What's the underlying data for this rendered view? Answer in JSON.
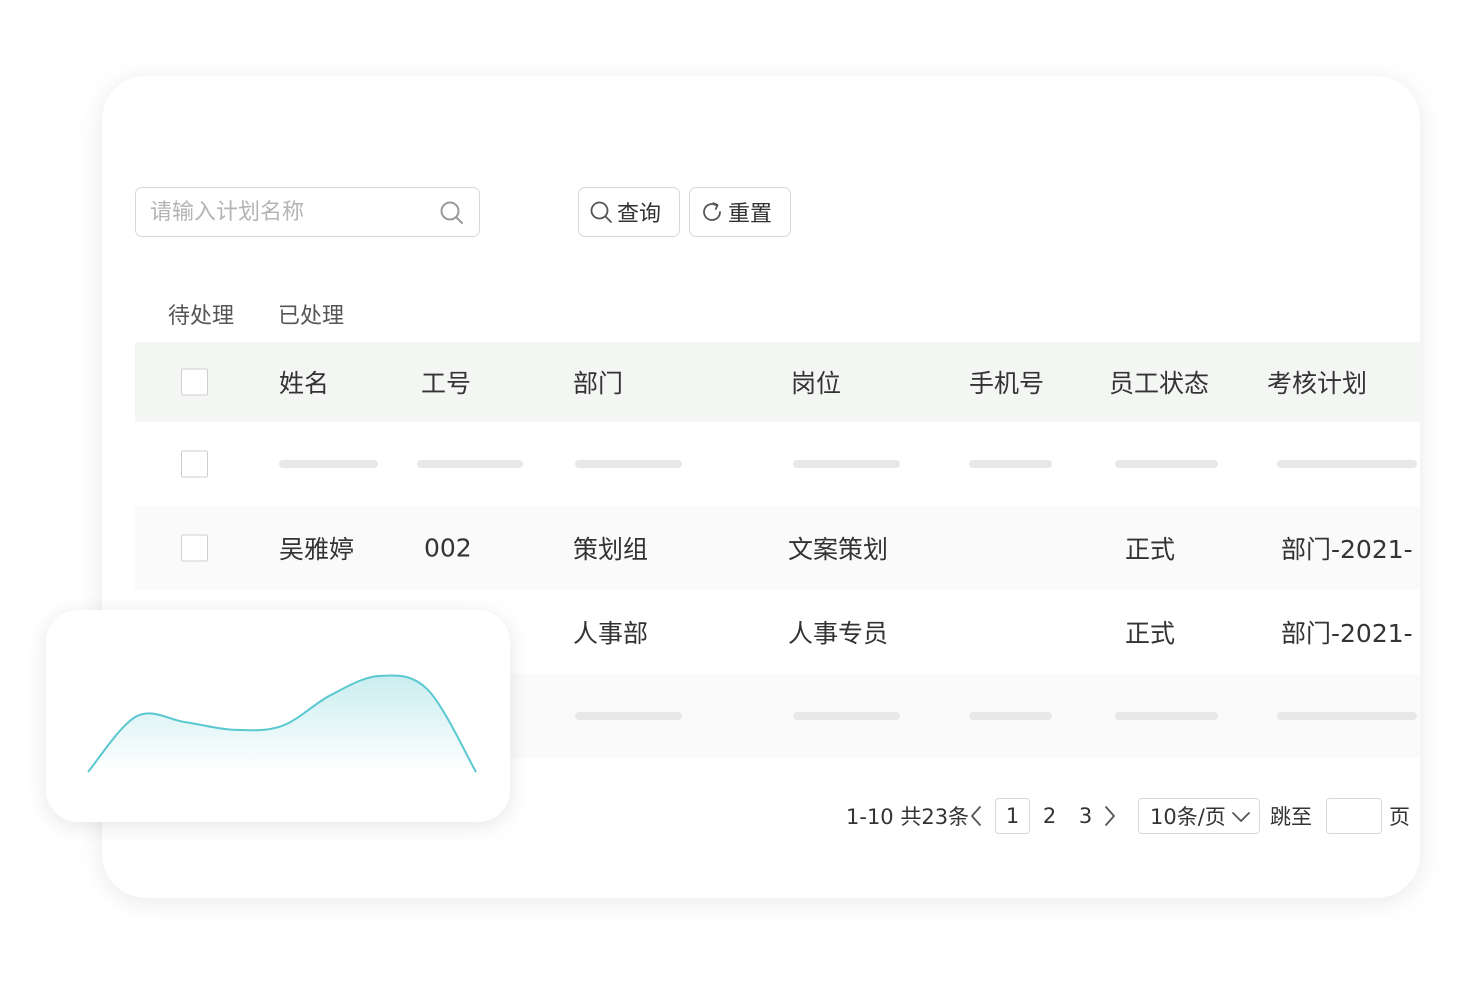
{
  "search": {
    "placeholder": "请输入计划名称"
  },
  "toolbar": {
    "query_label": "查询",
    "reset_label": "重置"
  },
  "tabs": [
    {
      "label": "待处理"
    },
    {
      "label": "已处理"
    }
  ],
  "table": {
    "columns": [
      "姓名",
      "工号",
      "部门",
      "岗位",
      "手机号",
      "员工状态",
      "考核计划"
    ],
    "rows": [
      {
        "name": "吴雅婷",
        "id": "002",
        "dept": "策划组",
        "post": "文案策划",
        "phone": "",
        "status": "正式",
        "plan": "部门-2021-"
      },
      {
        "name": "",
        "id": "",
        "dept": "人事部",
        "post": "人事专员",
        "phone": "",
        "status": "正式",
        "plan": "部门-2021-"
      }
    ]
  },
  "pagination": {
    "range": "1-10 共23条",
    "pages": [
      "1",
      "2",
      "3"
    ],
    "current": "1",
    "page_size": "10条/页",
    "jump_label": "跳至",
    "page_suffix": "页"
  },
  "colors": {
    "accent_line": "#5ac8d0",
    "header_bg": "#f4f6f4",
    "border": "#d8d8d8"
  },
  "chart_data": {
    "type": "area",
    "x": [
      0,
      1,
      2,
      3,
      4,
      5,
      6,
      7,
      8
    ],
    "series": [
      {
        "values": [
          0,
          58,
          52,
          44,
          48,
          80,
          100,
          86,
          0
        ]
      }
    ],
    "title": "",
    "xlabel": "",
    "ylabel": "",
    "ylim": [
      0,
      100
    ]
  }
}
